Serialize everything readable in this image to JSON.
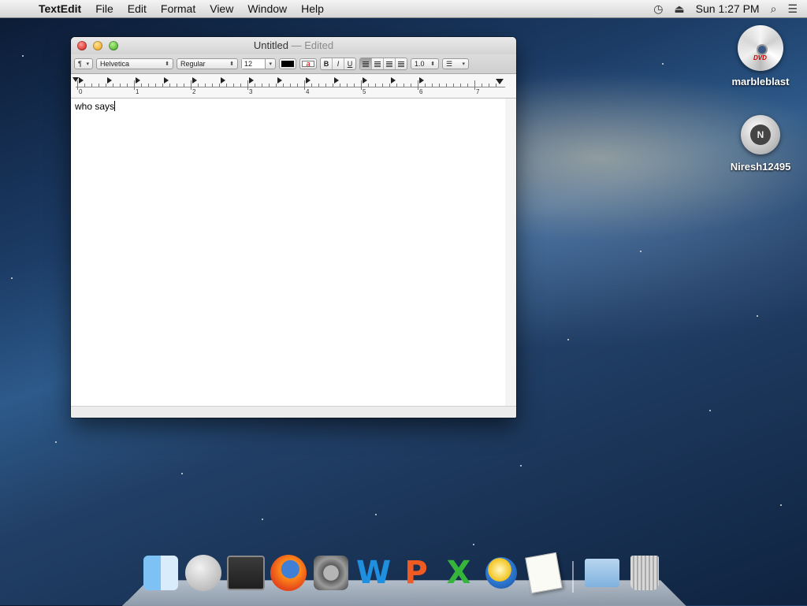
{
  "menubar": {
    "app_name": "TextEdit",
    "menus": [
      "File",
      "Edit",
      "Format",
      "View",
      "Window",
      "Help"
    ],
    "clock": "Sun 1:27 PM"
  },
  "window": {
    "title": "Untitled",
    "title_status": "— Edited",
    "toolbar": {
      "paragraph_label": "¶",
      "font_family": "Helvetica",
      "font_style": "Regular",
      "font_size": "12",
      "bold_label": "B",
      "italic_label": "I",
      "underline_label": "U",
      "highlight_label": "a",
      "line_spacing": "1.0",
      "text_color": "#000000"
    },
    "ruler": {
      "numbers": [
        "0",
        "1",
        "2",
        "3",
        "4",
        "5",
        "6",
        "7"
      ]
    },
    "document_text": "who says"
  },
  "desktop_icons": [
    {
      "label": "marbleblast",
      "icon": "dvd-icon"
    },
    {
      "label": "Niresh12495",
      "icon": "hard-drive-icon",
      "badge": "N"
    }
  ],
  "dock": {
    "apps": [
      "finder",
      "launchpad",
      "mission-control",
      "firefox",
      "system-preferences",
      "word",
      "powerpoint",
      "excel",
      "network-utility",
      "textedit",
      "documents-folder",
      "trash"
    ],
    "word_glyph": "W",
    "powerpoint_glyph": "P",
    "excel_glyph": "X"
  }
}
